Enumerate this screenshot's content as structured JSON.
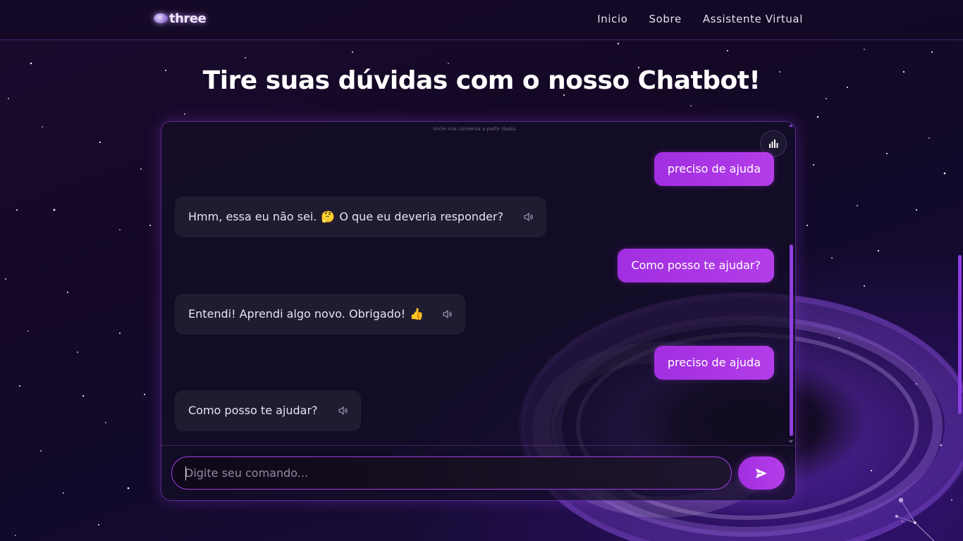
{
  "header": {
    "logo_text": "three",
    "nav": [
      "Inicio",
      "Sobre",
      "Assistente Virtual"
    ]
  },
  "main": {
    "title": "Tire suas dúvidas com o nosso Chatbot!"
  },
  "chat": {
    "hint": "Inicie sua conversa a partir daqui.",
    "messages": [
      {
        "role": "user",
        "text": "preciso de ajuda"
      },
      {
        "role": "bot",
        "text": "Hmm, essa eu não sei.",
        "emoji": "🤔",
        "text_after": "O que eu deveria responder?"
      },
      {
        "role": "user",
        "text": "Como posso te ajudar?"
      },
      {
        "role": "bot",
        "text": "Entendi! Aprendi algo novo. Obrigado!",
        "emoji": "👍"
      },
      {
        "role": "user",
        "text": "preciso de ajuda"
      },
      {
        "role": "bot",
        "text": "Como posso te ajudar?"
      }
    ],
    "input_placeholder": "Digite seu comando...",
    "icons": {
      "stats": "bar-chart-icon",
      "send": "send-icon",
      "speaker": "speaker-icon"
    }
  },
  "colors": {
    "accent": "#a12ee0",
    "bot_bubble": "#1f1b31",
    "background": "#140826"
  }
}
